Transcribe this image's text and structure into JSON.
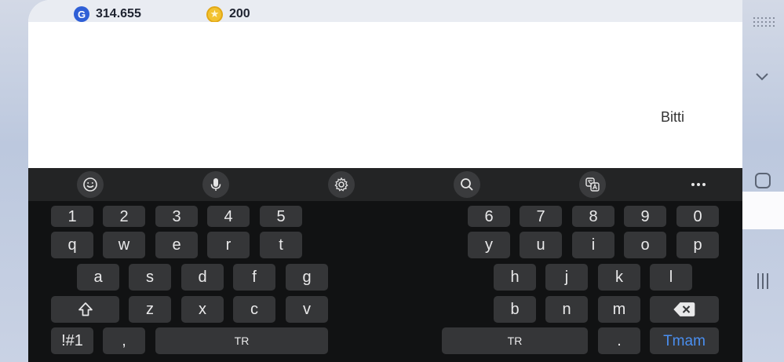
{
  "header": {
    "g_balance": "314.655",
    "coin_balance": "200"
  },
  "content": {
    "done_label": "Bitti"
  },
  "keyboard": {
    "numbers_left": [
      "1",
      "2",
      "3",
      "4",
      "5"
    ],
    "numbers_right": [
      "6",
      "7",
      "8",
      "9",
      "0"
    ],
    "row1_left": [
      "q",
      "w",
      "e",
      "r",
      "t"
    ],
    "row1_right": [
      "y",
      "u",
      "i",
      "o",
      "p"
    ],
    "row2_left": [
      "a",
      "s",
      "d",
      "f",
      "g"
    ],
    "row2_right": [
      "h",
      "j",
      "k",
      "l"
    ],
    "row3_left": [
      "z",
      "x",
      "c",
      "v"
    ],
    "row3_right": [
      "b",
      "n",
      "m"
    ],
    "symbols_label": "!#1",
    "comma_label": ",",
    "space_left_label": "TR",
    "space_right_label": "TR",
    "period_label": ".",
    "enter_label": "Tmam"
  },
  "colors": {
    "accent": "#4a8ff0",
    "key_bg": "#353638",
    "keyboard_bg": "#111213"
  },
  "icons": {
    "emoji": "emoji-icon",
    "mic": "microphone-icon",
    "settings": "gear-icon",
    "search": "search-icon",
    "translate": "translate-icon",
    "more": "more-icon",
    "shift": "shift-icon",
    "backspace": "backspace-icon"
  }
}
